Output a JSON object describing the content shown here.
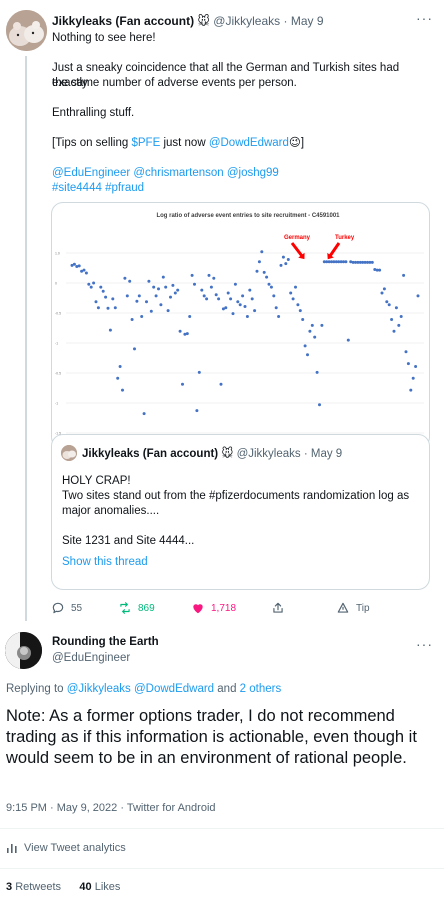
{
  "tweet": {
    "author_name": "Jikkyleaks (Fan account)",
    "author_emoji": "🐭",
    "handle": "@Jikkyleaks",
    "date": "May 9",
    "more": "···",
    "lines": [
      "Nothing to see here!",
      "Just a sneaky coincidence that all the German and Turkish sites had exactly",
      "the same number of adverse events per person.",
      "Enthralling stuff."
    ],
    "tips_prefix": "[Tips on selling ",
    "cashtag": "$PFE",
    "tips_mid": " just now ",
    "tips_mention": "@DowdEdward",
    "tips_emoji": "😉",
    "tips_suffix": "]",
    "mentions_line": "@EduEngineer @chrismartenson @joshg99",
    "hashtags_line": "#site4444 #pfraud"
  },
  "chart_data": {
    "type": "scatter",
    "title": "Log ratio of adverse event entries to site recruitment - C4591001",
    "annotations": [
      "Germany",
      "Turkey"
    ],
    "y_ticks": [
      "1.0",
      "0",
      "-0.5",
      "-1",
      "-0.5",
      "-1",
      "-1.5"
    ],
    "ylim": [
      -2.2,
      1.2
    ],
    "grid": true,
    "points": [
      [
        1,
        0.82
      ],
      [
        2,
        0.84
      ],
      [
        3,
        0.8
      ],
      [
        4,
        0.81
      ],
      [
        5,
        0.72
      ],
      [
        6,
        0.74
      ],
      [
        7,
        0.69
      ],
      [
        8,
        0.5
      ],
      [
        9,
        0.45
      ],
      [
        10,
        0.52
      ],
      [
        11,
        0.2
      ],
      [
        12,
        0.1
      ],
      [
        13,
        0.45
      ],
      [
        14,
        0.38
      ],
      [
        15,
        0.28
      ],
      [
        16,
        0.09
      ],
      [
        17,
        -0.28
      ],
      [
        18,
        0.25
      ],
      [
        19,
        0.1
      ],
      [
        20,
        -1.1
      ],
      [
        21,
        -0.9
      ],
      [
        22,
        -1.3
      ],
      [
        23,
        0.6
      ],
      [
        24,
        0.3
      ],
      [
        25,
        0.55
      ],
      [
        26,
        -0.1
      ],
      [
        27,
        -0.6
      ],
      [
        28,
        0.21
      ],
      [
        29,
        0.3
      ],
      [
        30,
        -0.05
      ],
      [
        31,
        -1.7
      ],
      [
        32,
        0.2
      ],
      [
        33,
        0.55
      ],
      [
        34,
        0.04
      ],
      [
        35,
        0.45
      ],
      [
        36,
        0.3
      ],
      [
        37,
        0.42
      ],
      [
        38,
        0.15
      ],
      [
        39,
        0.62
      ],
      [
        40,
        0.45
      ],
      [
        41,
        0.05
      ],
      [
        42,
        0.28
      ],
      [
        43,
        0.48
      ],
      [
        44,
        0.35
      ],
      [
        45,
        0.4
      ],
      [
        46,
        -0.3
      ],
      [
        47,
        -1.2
      ],
      [
        48,
        -0.35
      ],
      [
        49,
        -0.34
      ],
      [
        50,
        -0.05
      ],
      [
        51,
        0.65
      ],
      [
        52,
        0.5
      ],
      [
        53,
        -1.65
      ],
      [
        54,
        -1.0
      ],
      [
        55,
        0.4
      ],
      [
        56,
        0.3
      ],
      [
        57,
        0.25
      ],
      [
        58,
        0.65
      ],
      [
        59,
        0.45
      ],
      [
        60,
        0.6
      ],
      [
        61,
        0.32
      ],
      [
        62,
        0.25
      ],
      [
        63,
        -1.2
      ],
      [
        64,
        0.08
      ],
      [
        65,
        0.1
      ],
      [
        66,
        0.35
      ],
      [
        67,
        0.25
      ],
      [
        68,
        0.0
      ],
      [
        69,
        0.5
      ],
      [
        70,
        0.2
      ],
      [
        71,
        0.15
      ],
      [
        72,
        0.3
      ],
      [
        73,
        0.12
      ],
      [
        74,
        -0.05
      ],
      [
        75,
        0.4
      ],
      [
        76,
        0.25
      ],
      [
        77,
        0.05
      ],
      [
        78,
        0.72
      ],
      [
        79,
        0.88
      ],
      [
        80,
        1.05
      ],
      [
        81,
        0.7
      ],
      [
        82,
        0.62
      ],
      [
        83,
        0.5
      ],
      [
        84,
        0.45
      ],
      [
        85,
        0.3
      ],
      [
        86,
        0.1
      ],
      [
        87,
        -0.05
      ],
      [
        88,
        0.82
      ],
      [
        89,
        0.96
      ],
      [
        90,
        0.85
      ],
      [
        91,
        0.92
      ],
      [
        92,
        0.35
      ],
      [
        93,
        0.25
      ],
      [
        94,
        0.45
      ],
      [
        95,
        0.15
      ],
      [
        96,
        0.05
      ],
      [
        97,
        -0.1
      ],
      [
        98,
        -0.55
      ],
      [
        99,
        -0.7
      ],
      [
        100,
        -0.3
      ],
      [
        101,
        -0.2
      ],
      [
        102,
        -0.4
      ],
      [
        103,
        -1.0
      ],
      [
        104,
        -1.55
      ],
      [
        105,
        -0.2
      ],
      [
        106,
        0.88
      ],
      [
        107,
        0.88
      ],
      [
        108,
        0.88
      ],
      [
        109,
        0.88
      ],
      [
        110,
        0.88
      ],
      [
        111,
        0.88
      ],
      [
        112,
        0.88
      ],
      [
        113,
        0.88
      ],
      [
        114,
        0.88
      ],
      [
        115,
        0.88
      ],
      [
        116,
        -0.45
      ],
      [
        117,
        0.88
      ],
      [
        118,
        0.87
      ],
      [
        119,
        0.87
      ],
      [
        120,
        0.87
      ],
      [
        121,
        0.87
      ],
      [
        122,
        0.87
      ],
      [
        123,
        0.87
      ],
      [
        124,
        0.87
      ],
      [
        125,
        0.87
      ],
      [
        126,
        0.87
      ],
      [
        127,
        0.75
      ],
      [
        128,
        0.74
      ],
      [
        129,
        0.74
      ],
      [
        130,
        0.35
      ],
      [
        131,
        0.42
      ],
      [
        132,
        0.2
      ],
      [
        133,
        0.15
      ],
      [
        134,
        -0.1
      ],
      [
        135,
        -0.3
      ],
      [
        136,
        0.1
      ],
      [
        137,
        -0.2
      ],
      [
        138,
        -0.05
      ],
      [
        139,
        0.65
      ],
      [
        140,
        -0.65
      ],
      [
        141,
        -0.85
      ],
      [
        142,
        -1.3
      ],
      [
        143,
        -1.1
      ],
      [
        144,
        -0.9
      ],
      [
        145,
        0.3
      ]
    ]
  },
  "quote": {
    "author_name": "Jikkyleaks (Fan account)",
    "author_emoji": "🐭",
    "handle": "@Jikkyleaks",
    "date": "May 9",
    "line1": "HOLY CRAP!",
    "line2": "Two sites stand out from the #pfizerdocuments randomization log as",
    "line3": "major anomalies....",
    "line4": "Site 1231 and Site 4444...",
    "show_thread": "Show this thread"
  },
  "actions": {
    "replies": "55",
    "retweets": "869",
    "likes": "1,718",
    "tip": "Tip"
  },
  "reply_tweet": {
    "author_name": "Rounding the Earth",
    "handle": "@EduEngineer",
    "more": "···",
    "replying_prefix": "Replying to ",
    "replying_to": "@Jikkyleaks @DowdEdward",
    "replying_and": " and ",
    "replying_others": "2 others",
    "text": "Note: As a former options trader, I do not recommend trading as if this information is actionable, even though it would seem to be in an environment of rational people.",
    "timestamp": "9:15 PM · May 9, 2022 · Twitter for Android",
    "analytics": "View Tweet analytics",
    "retweets_count": "3",
    "retweets_label": "Retweets",
    "likes_count": "40",
    "likes_label": "Likes"
  },
  "colors": {
    "accent": "#1d9bf0",
    "retweet": "#00ba7c",
    "like": "#f91880",
    "muted": "#536471",
    "chart_point": "#4472c4",
    "chart_arrow": "#ff0000"
  }
}
